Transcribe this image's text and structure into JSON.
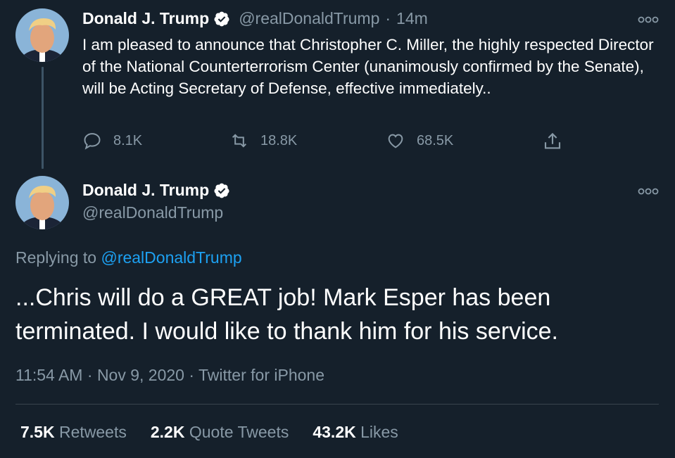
{
  "tweet1": {
    "name": "Donald J. Trump",
    "handle": "@realDonaldTrump",
    "separator": "·",
    "time": "14m",
    "text": "I am pleased to announce that Christopher C. Miller, the highly respected Director of the National Counterterrorism Center (unanimously confirmed by the Senate), will be Acting Secretary of Defense, effective immediately..",
    "replies": "8.1K",
    "retweets": "18.8K",
    "likes": "68.5K",
    "icons": [
      "verified-badge-icon",
      "more-dots-icon",
      "reply-icon",
      "retweet-icon",
      "like-icon",
      "share-icon"
    ]
  },
  "tweet2": {
    "name": "Donald J. Trump",
    "handle": "@realDonaldTrump",
    "replying_prefix": "Replying to",
    "replying_to": "@realDonaldTrump",
    "text": "...Chris will do a GREAT job! Mark Esper has been terminated. I would like to thank him for his service.",
    "time": "11:54 AM",
    "date": "Nov 9, 2020",
    "client": "Twitter for iPhone",
    "meta_separator": "·",
    "stats": {
      "retweets_count": "7.5K",
      "retweets_label": "Retweets",
      "quotes_count": "2.2K",
      "quotes_label": "Quote Tweets",
      "likes_count": "43.2K",
      "likes_label": "Likes"
    }
  },
  "colors": {
    "background": "#15202b",
    "text": "#ffffff",
    "secondary": "#8899a6",
    "link": "#1da1f2",
    "divider": "#38444d"
  }
}
